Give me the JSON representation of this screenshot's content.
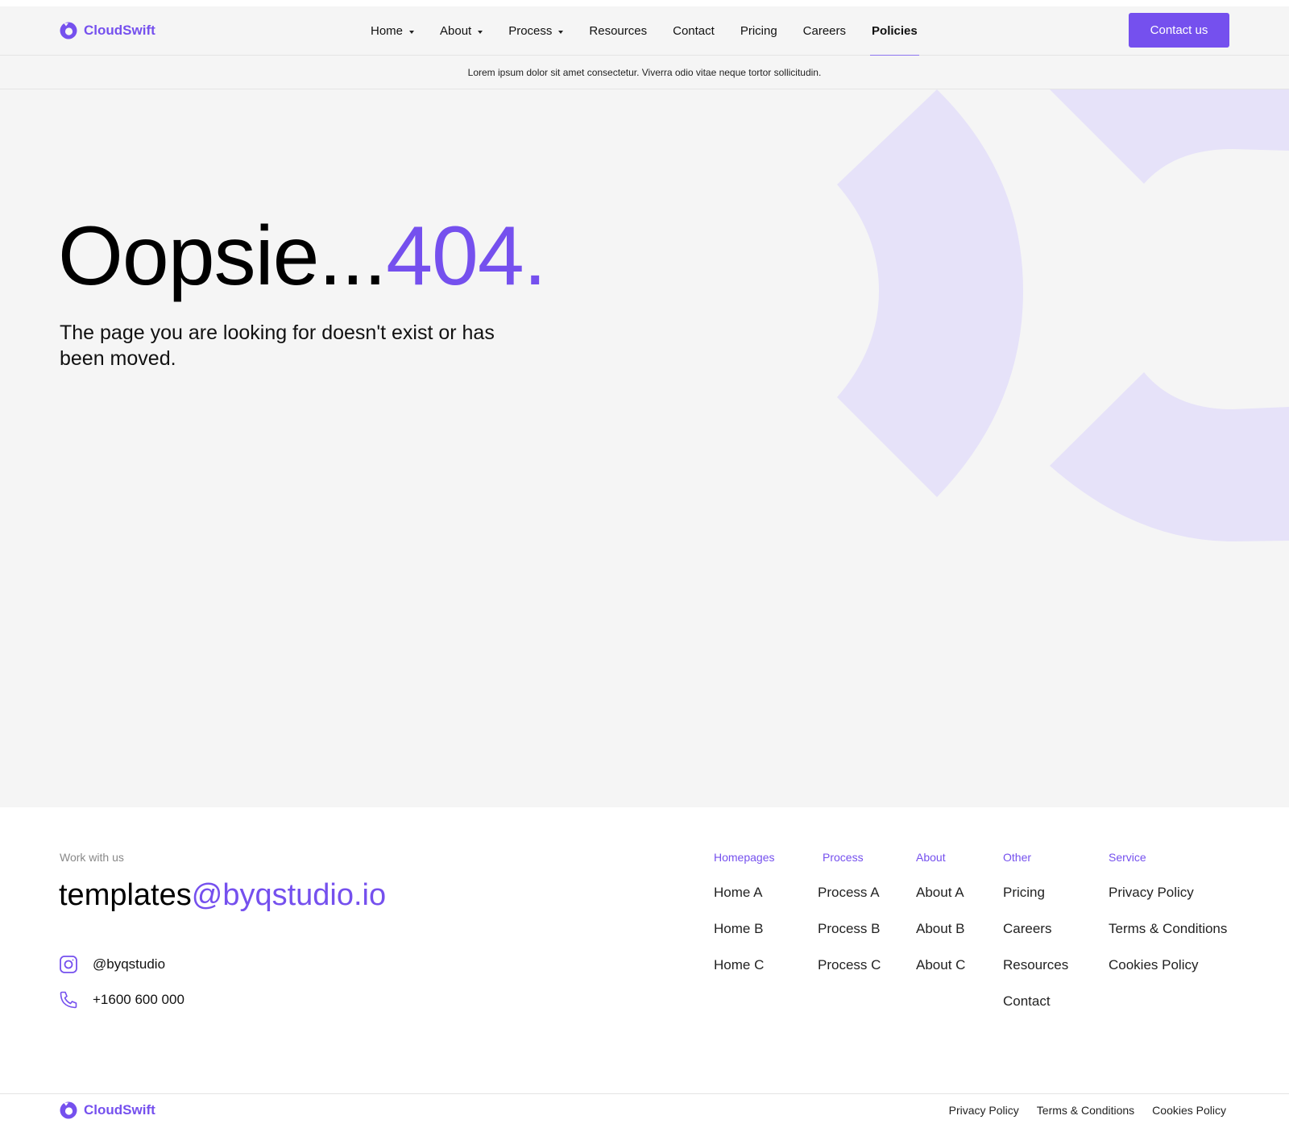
{
  "brand": {
    "name": "CloudSwift",
    "accent_color": "#7550ee"
  },
  "nav": {
    "items": [
      {
        "label": "Home",
        "has_dropdown": true
      },
      {
        "label": "About",
        "has_dropdown": true
      },
      {
        "label": "Process",
        "has_dropdown": true
      },
      {
        "label": "Resources",
        "has_dropdown": false
      },
      {
        "label": "Contact",
        "has_dropdown": false
      },
      {
        "label": "Pricing",
        "has_dropdown": false
      },
      {
        "label": "Careers",
        "has_dropdown": false
      },
      {
        "label": "Policies",
        "has_dropdown": false,
        "active": true
      }
    ],
    "cta_label": "Contact us"
  },
  "announcement": {
    "text": "Lorem ipsum dolor sit amet consectetur. Viverra odio vitae neque tortor sollicitudin."
  },
  "hero": {
    "title_prefix": "Oopsie...",
    "title_code": "404",
    "title_suffix": ".",
    "subtitle": "The page you are looking for doesn't exist or has been moved."
  },
  "footer": {
    "work_label": "Work with us",
    "email_user": "templates",
    "email_domain": "@byqstudio.io",
    "instagram": "@byqstudio",
    "phone": "+1600 600 000",
    "columns": [
      {
        "heading": "Homepages",
        "links": [
          "Home A",
          "Home B",
          "Home C"
        ]
      },
      {
        "heading": "Process",
        "links": [
          "Process A",
          "Process B",
          "Process C"
        ]
      },
      {
        "heading": "About",
        "links": [
          "About A",
          "About B",
          "About C"
        ]
      },
      {
        "heading": "Other",
        "links": [
          "Pricing",
          "Careers",
          "Resources",
          "Contact"
        ]
      },
      {
        "heading": "Service",
        "links": [
          "Privacy Policy",
          "Terms & Conditions",
          "Cookies Policy"
        ]
      }
    ]
  },
  "bottom_bar": {
    "links": [
      "Privacy Policy",
      "Terms & Conditions",
      "Cookies Policy"
    ]
  }
}
